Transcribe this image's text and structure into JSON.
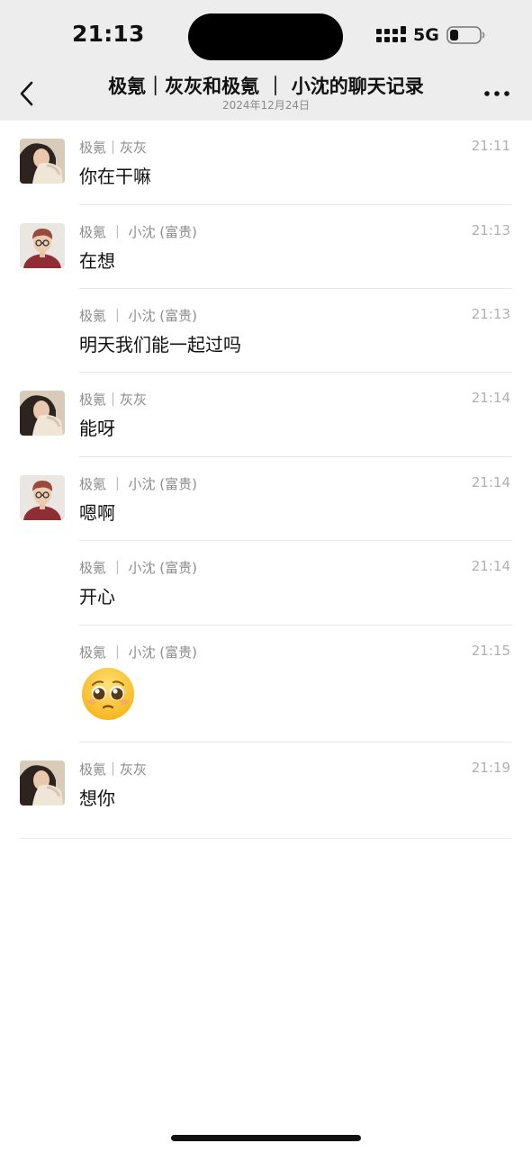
{
  "status_bar": {
    "time": "21:13",
    "network": "5G",
    "icons": [
      "signal-icon",
      "battery-icon"
    ]
  },
  "nav": {
    "title": "极氪｜灰灰和极氪 ｜ 小沈的聊天记录",
    "subtitle": "2024年12月24日",
    "icons": [
      "back-icon",
      "more-icon"
    ]
  },
  "messages": [
    {
      "sender": "极氪｜灰灰",
      "time": "21:11",
      "text": "你在干嘛",
      "avatar": "female"
    },
    {
      "sender": "极氪 ｜ 小沈 (富贵)",
      "time": "21:13",
      "text": "在想",
      "avatar": "male"
    },
    {
      "sender": "极氪 ｜ 小沈 (富贵)",
      "time": "21:13",
      "text": "明天我们能一起过吗",
      "avatar": ""
    },
    {
      "sender": "极氪｜灰灰",
      "time": "21:14",
      "text": "能呀",
      "avatar": "female"
    },
    {
      "sender": "极氪 ｜ 小沈 (富贵)",
      "time": "21:14",
      "text": "嗯啊",
      "avatar": "male"
    },
    {
      "sender": "极氪 ｜ 小沈 (富贵)",
      "time": "21:14",
      "text": "开心",
      "avatar": ""
    },
    {
      "sender": "极氪 ｜ 小沈 (富贵)",
      "time": "21:15",
      "text": "",
      "emoji": "pleading-face-emoji",
      "avatar": ""
    },
    {
      "sender": "极氪｜灰灰",
      "time": "21:19",
      "text": "想你",
      "avatar": "female"
    }
  ],
  "colors": {
    "header_bg": "#ededed",
    "text_primary": "#111111",
    "text_secondary": "#8c8c8c",
    "timestamp": "#b0b0b0"
  }
}
